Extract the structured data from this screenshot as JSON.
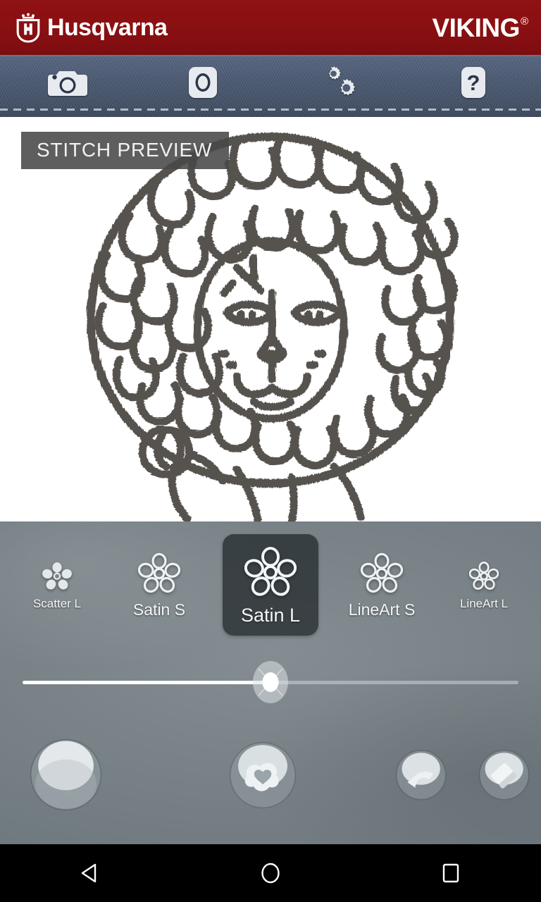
{
  "brand": {
    "mark_icon": "husqvarna-crown-h-icon",
    "name": "Husqvarna",
    "secondary_name": "VIKING",
    "registered_mark": "®",
    "bar_color": "#8b1012"
  },
  "toolbar": {
    "background": "denim",
    "items": [
      {
        "icon": "camera-icon",
        "name": "camera"
      },
      {
        "icon": "photo-icon",
        "name": "gallery"
      },
      {
        "icon": "gears-icon",
        "name": "settings"
      },
      {
        "icon": "question-icon",
        "name": "help"
      }
    ]
  },
  "preview": {
    "badge": "STITCH PREVIEW",
    "artwork_name": "embroidered-lion",
    "thread_color": "#56524f",
    "background": "#ffffff"
  },
  "carousel": {
    "selected_index": 2,
    "items": [
      {
        "label": "Scatter L",
        "icon": "flower-filled-icon",
        "size": "xs"
      },
      {
        "label": "Satin S",
        "icon": "flower-outline-icon",
        "size": "s"
      },
      {
        "label": "Satin L",
        "icon": "flower-outline-icon",
        "size": "l"
      },
      {
        "label": "LineArt S",
        "icon": "flower-outline-icon",
        "size": "s"
      },
      {
        "label": "LineArt L",
        "icon": "flower-outline-icon",
        "size": "xs"
      }
    ]
  },
  "slider": {
    "name": "stitch-density-slider",
    "value": 50,
    "min": 0,
    "max": 100,
    "fill_color": "#ffffff",
    "track_color": "#cdd4d8",
    "thumb_icon": "thread-spool-icon"
  },
  "actions": [
    {
      "name": "stitch-out-button",
      "icon": "blank-button-icon"
    },
    {
      "name": "save-favorite-button",
      "icon": "cloud-heart-icon"
    },
    {
      "name": "undo-button",
      "icon": "undo-arrow-icon"
    },
    {
      "name": "erase-button",
      "icon": "eraser-icon"
    }
  ],
  "navbar": [
    {
      "name": "back-button",
      "icon": "triangle-back-icon"
    },
    {
      "name": "home-button",
      "icon": "circle-home-icon"
    },
    {
      "name": "recents-button",
      "icon": "square-recents-icon"
    }
  ],
  "panel": {
    "background_color": "#7a8388"
  }
}
